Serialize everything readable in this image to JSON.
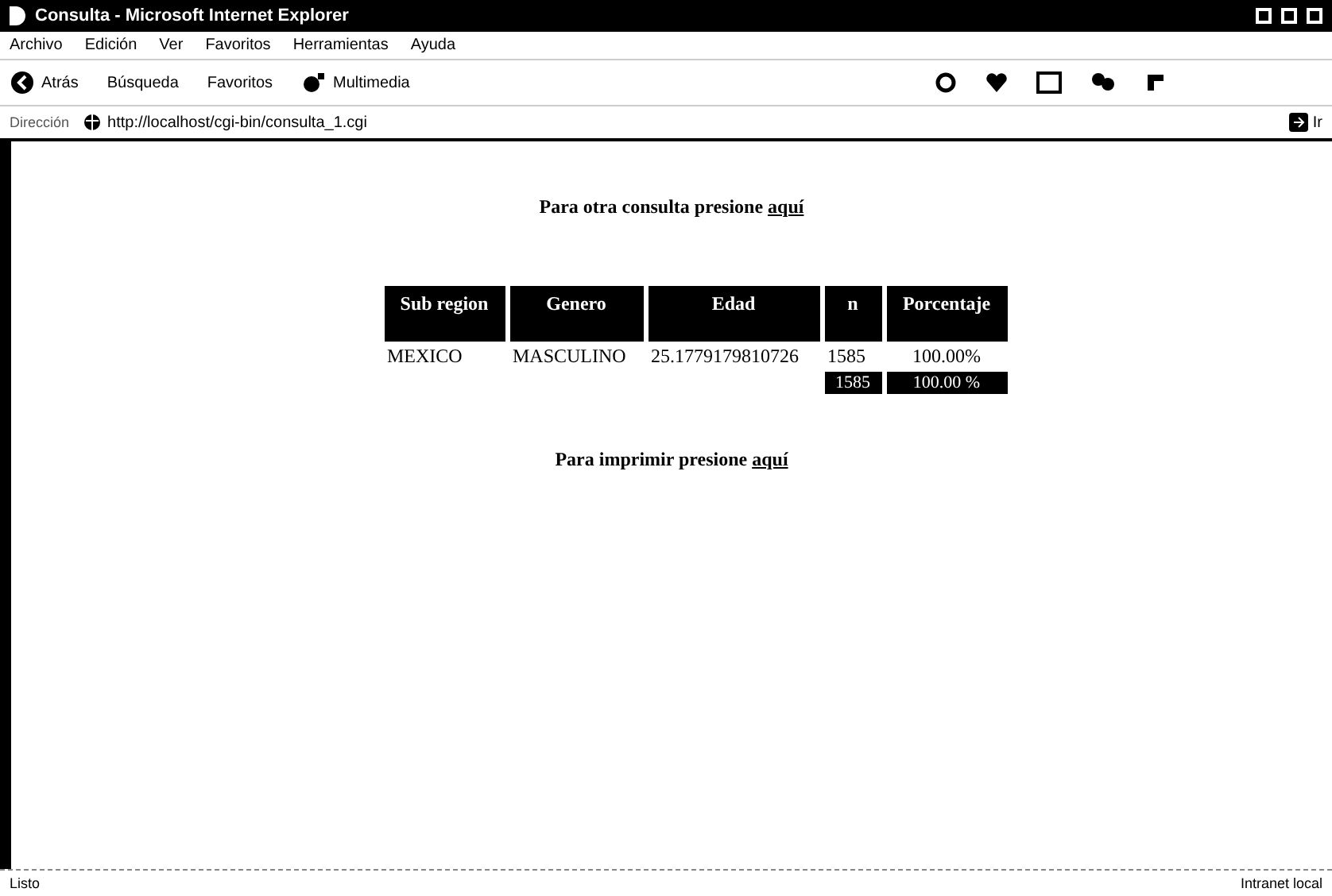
{
  "window": {
    "title": "Consulta - Microsoft Internet Explorer"
  },
  "menu": [
    "Archivo",
    "Edición",
    "Ver",
    "Favoritos",
    "Herramientas",
    "Ayuda"
  ],
  "toolbar": [
    {
      "kind": "back",
      "label": "Atrás"
    },
    {
      "kind": "search",
      "label": "Búsqueda"
    },
    {
      "kind": "favorites",
      "label": "Favoritos"
    },
    {
      "kind": "media",
      "label": "Multimedia"
    }
  ],
  "address": {
    "label": "Dirección",
    "value": "http://localhost/cgi-bin/consulta_1.cgi",
    "go": "Ir"
  },
  "page": {
    "top_text": "Para otra consulta presione",
    "top_link": "aquí",
    "table": {
      "columns": [
        "Sub region",
        "Genero",
        "Edad",
        "n",
        "Porcentaje"
      ],
      "rows": [
        [
          "MEXICO",
          "MASCULINO",
          "25.1779179810726",
          "1585",
          "100.00%"
        ]
      ],
      "totals": [
        "1585",
        "100.00 %"
      ]
    },
    "bottom_text": "Para imprimir presione",
    "bottom_link": "aquí"
  },
  "status_bar": {
    "text": "Listo",
    "zone": "Intranet local"
  }
}
